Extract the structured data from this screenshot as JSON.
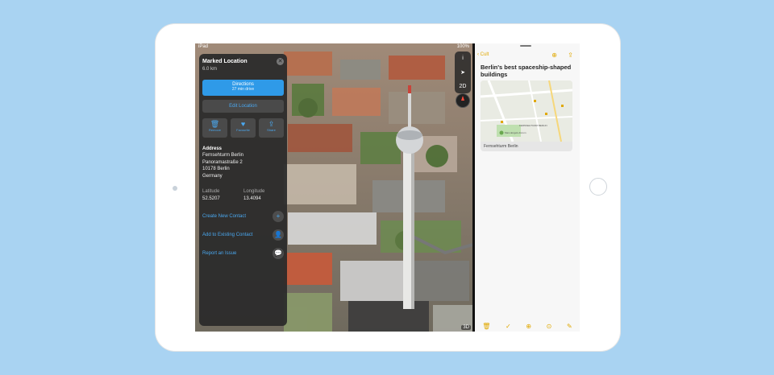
{
  "status_bar": {
    "left": "iPad",
    "right": "100%"
  },
  "map_controls": {
    "info_icon": "i",
    "location_icon": "location-arrow-icon",
    "mode_label": "2D"
  },
  "map_footer": "3D",
  "place_card": {
    "title": "Marked Location",
    "distance": "6.0 km",
    "directions_label": "Directions",
    "directions_sub": "27 min drive",
    "edit_label": "Edit Location",
    "actions": [
      {
        "label": "Remove",
        "icon": "trash-icon"
      },
      {
        "label": "Favourite",
        "icon": "heart-icon"
      },
      {
        "label": "Share",
        "icon": "share-icon"
      }
    ],
    "address_label": "Address",
    "address_lines": [
      "Fernsehturm Berlin",
      "Panoramastraße 2",
      "10178 Berlin",
      "Germany"
    ],
    "latitude_label": "Latitude",
    "latitude_value": "52.5207",
    "longitude_label": "Longitude",
    "longitude_value": "13.4094",
    "links": [
      {
        "label": "Create New Contact",
        "icon": "plus-icon"
      },
      {
        "label": "Add to Existing Contact",
        "icon": "add-contact-icon"
      },
      {
        "label": "Report an Issue",
        "icon": "speech-bubble-icon"
      }
    ]
  },
  "notes": {
    "back_label": "Cult",
    "title": "Berlin's best spaceship-shaped buildings",
    "map_caption": "Fernsehturm Berlin",
    "map_labels": {
      "place": "FERNSEHTURM BERLIN",
      "pin": "Marx-Engels-Forum"
    },
    "toolbar_icons": [
      "trash-icon",
      "checklist-icon",
      "plus-circle-icon",
      "compass-icon",
      "compose-icon"
    ]
  },
  "colors": {
    "accent_blue": "#2f9ae8",
    "notes_accent": "#e0a800",
    "background": "#a9d3f2"
  }
}
